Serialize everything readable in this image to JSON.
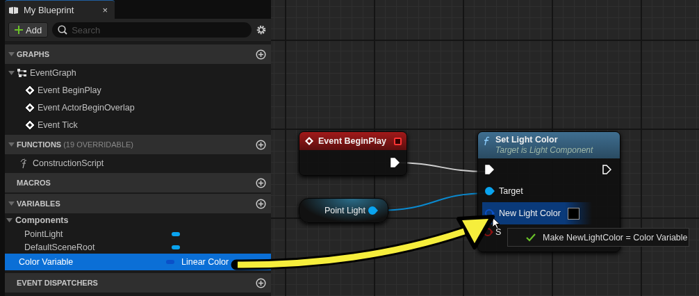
{
  "panel": {
    "tab": {
      "title": "My Blueprint",
      "close": "×"
    },
    "add_button": "Add",
    "search": {
      "placeholder": "Search"
    },
    "sections": [
      {
        "title": "GRAPHS",
        "expanded": true,
        "items": [
          {
            "label": "EventGraph",
            "kind": "graph",
            "expanded": true,
            "children": [
              {
                "label": "Event BeginPlay",
                "kind": "event"
              },
              {
                "label": "Event ActorBeginOverlap",
                "kind": "event"
              },
              {
                "label": "Event Tick",
                "kind": "event"
              }
            ]
          }
        ]
      },
      {
        "title": "FUNCTIONS",
        "note": "(19 OVERRIDABLE)",
        "expanded": true,
        "items": [
          {
            "label": "ConstructionScript",
            "kind": "function"
          }
        ]
      },
      {
        "title": "MACROS"
      },
      {
        "title": "VARIABLES",
        "expanded": true,
        "categories": [
          {
            "label": "Components",
            "expanded": true,
            "items": [
              {
                "label": "PointLight",
                "color": "#0aa4f0",
                "selected": false
              },
              {
                "label": "DefaultSceneRoot",
                "color": "#0aa4f0",
                "selected": false
              }
            ]
          }
        ],
        "items": [
          {
            "label": "Color Variable",
            "type": "Linear Color",
            "color": "#0a50c8",
            "selected": true
          }
        ]
      },
      {
        "title": "EVENT DISPATCHERS"
      }
    ]
  },
  "graph": {
    "nodes": [
      {
        "kind": "event",
        "title": "Event BeginPlay"
      },
      {
        "kind": "getter",
        "title": "Point Light"
      },
      {
        "kind": "function",
        "title": "Set Light Color",
        "subtitle": "Target is Light Component",
        "pins": [
          {
            "label": "Target",
            "kind": "object",
            "highlighted": false
          },
          {
            "label": "New Light Color",
            "kind": "color",
            "highlighted": true
          },
          {
            "label": "S",
            "kind": "struct",
            "highlighted": false
          }
        ]
      }
    ],
    "tooltip": "Make NewLightColor = Color Variable"
  }
}
